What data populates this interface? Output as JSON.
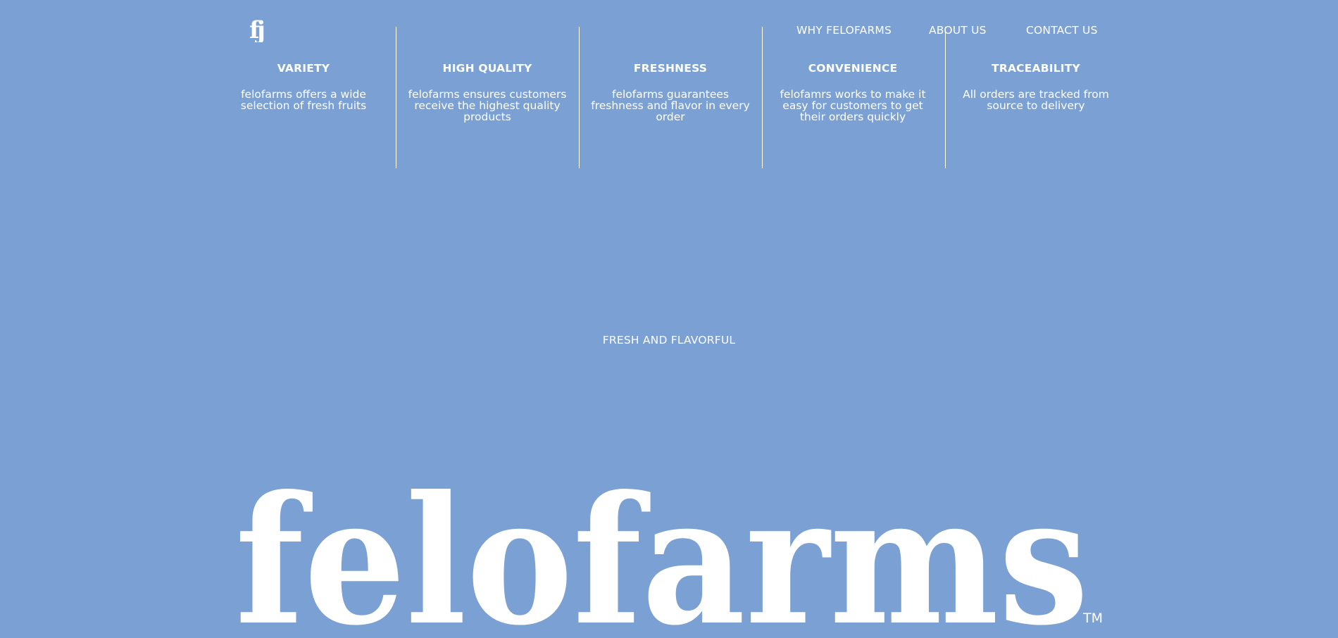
{
  "header": {
    "logo_icon": "fj-monogram-logo",
    "nav": [
      {
        "label": "WHY FELOFARMS"
      },
      {
        "label": "ABOUT US"
      },
      {
        "label": "CONTACT US"
      }
    ]
  },
  "features": [
    {
      "title": "VARIETY",
      "description": "felofarms offers a wide selection of fresh fruits"
    },
    {
      "title": "HIGH QUALITY",
      "description": "felofarms ensures customers receive the highest quality products"
    },
    {
      "title": "FRESHNESS",
      "description": "felofarms guarantees freshness and flavor in every order"
    },
    {
      "title": "CONVENIENCE",
      "description": "felofamrs works to make it easy for customers to get their orders quickly"
    },
    {
      "title": "TRACEABILITY",
      "description": "All orders are tracked from source to delivery"
    }
  ],
  "hero": {
    "tagline": "FRESH AND FLAVORFUL",
    "wordmark": "felofarms",
    "trademark": "TM"
  },
  "colors": {
    "background": "#7ba1d4",
    "foreground": "#ffffff"
  }
}
